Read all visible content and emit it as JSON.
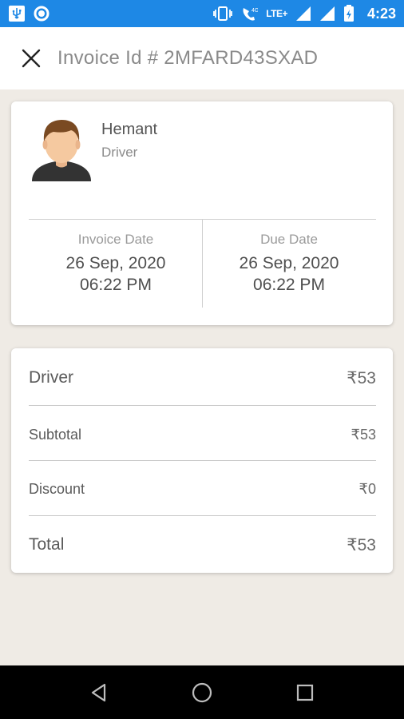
{
  "status_bar": {
    "time": "4:23",
    "network_label": "LTE+",
    "signal_label": "4G",
    "icons": [
      "usb-icon",
      "circle-notification-icon",
      "vibrate-icon",
      "volte-call-icon",
      "signal-icon",
      "signal-icon",
      "battery-icon"
    ],
    "background_color": "#1e88e5"
  },
  "app_bar": {
    "close_icon": "close-icon",
    "title": "Invoice Id # 2MFARD43SXAD"
  },
  "profile": {
    "name": "Hemant",
    "role": "Driver",
    "avatar_icon": "person-avatar-icon"
  },
  "dates": {
    "invoice": {
      "label": "Invoice Date",
      "date": "26 Sep, 2020",
      "time": "06:22 PM"
    },
    "due": {
      "label": "Due Date",
      "date": "26 Sep, 2020",
      "time": "06:22 PM"
    }
  },
  "bill": {
    "rows": [
      {
        "label": "Driver",
        "amount": "₹53"
      },
      {
        "label": "Subtotal",
        "amount": "₹53"
      },
      {
        "label": "Discount",
        "amount": "₹0"
      },
      {
        "label": "Total",
        "amount": "₹53"
      }
    ]
  },
  "nav_bar": {
    "icons": [
      "back-triangle-icon",
      "home-circle-icon",
      "recents-square-icon"
    ]
  }
}
